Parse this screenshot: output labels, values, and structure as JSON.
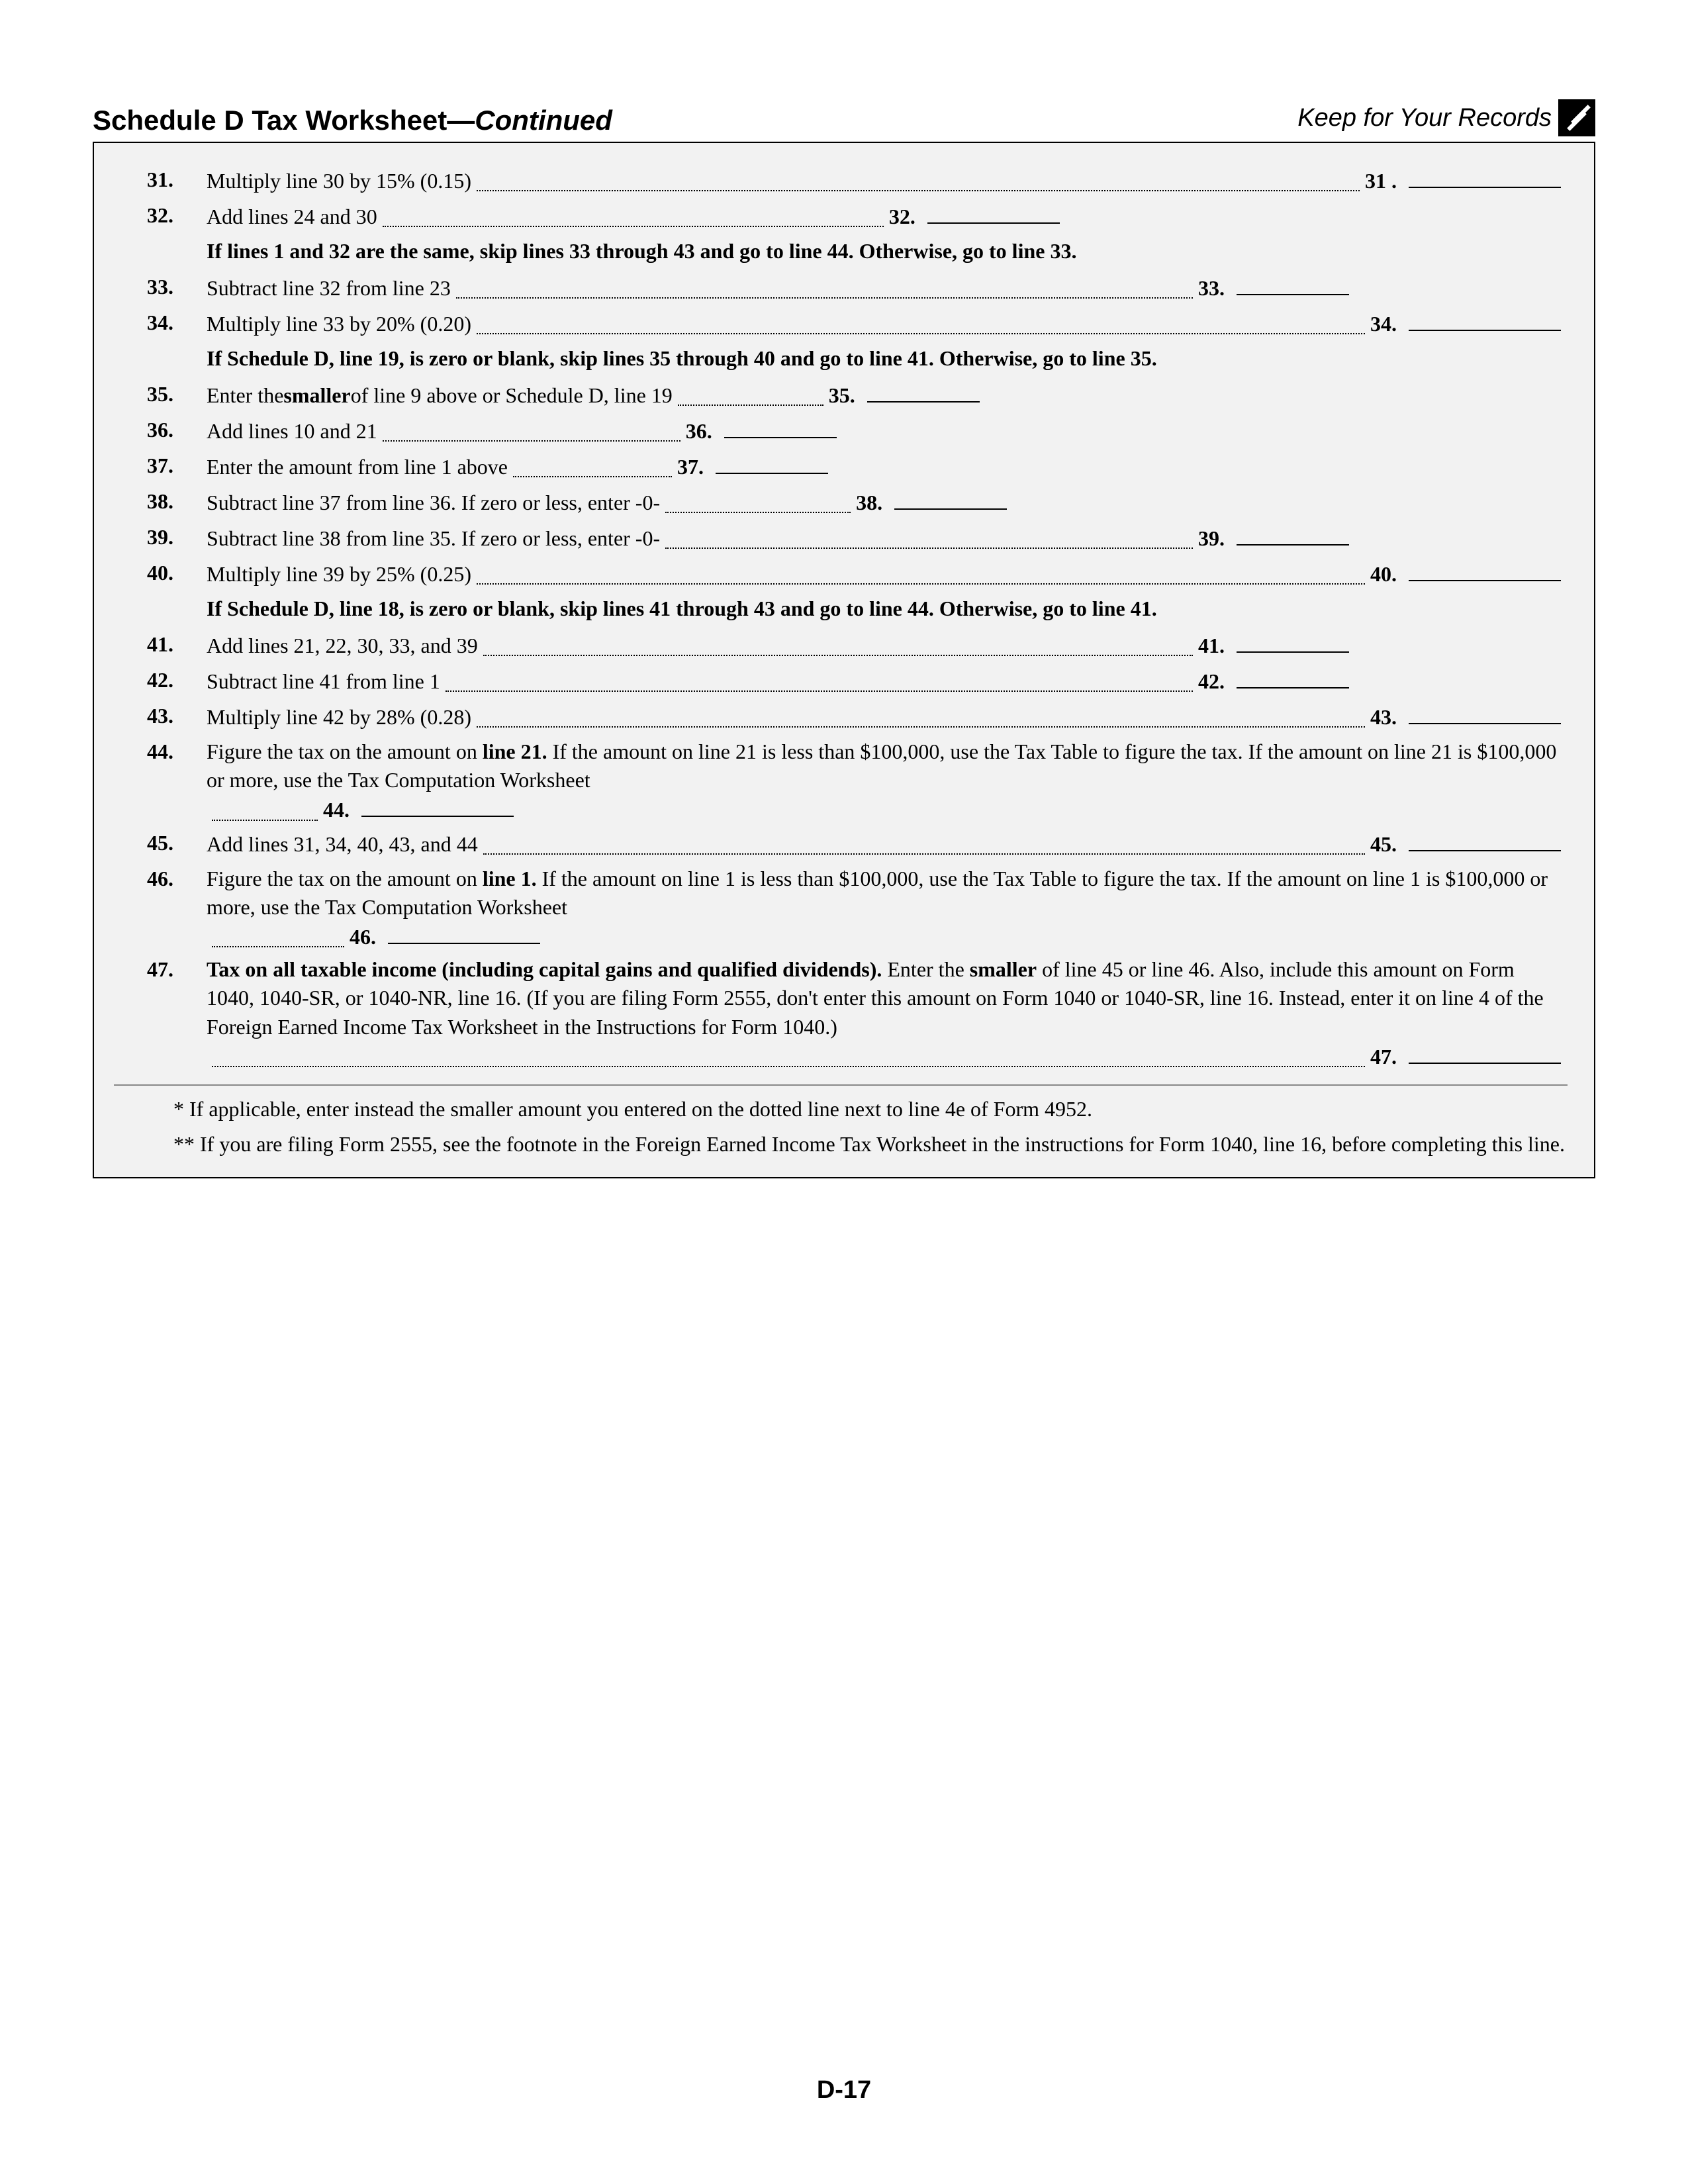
{
  "header": {
    "title_main": "Schedule D Tax Worksheet—",
    "title_cont": "Continued",
    "keep_records": "Keep for Your Records"
  },
  "lines": {
    "31": {
      "num": "31.",
      "text": "Multiply line 30 by 15% (0.15)",
      "end": "31 ."
    },
    "32": {
      "num": "32.",
      "text": "Add lines 24 and 30",
      "end": "32."
    },
    "instr_32": "If lines 1 and 32 are the same, skip lines 33 through 43 and go to line 44. Otherwise, go to line 33.",
    "33": {
      "num": "33.",
      "text": "Subtract line 32 from line 23",
      "end": "33."
    },
    "34": {
      "num": "34.",
      "text": "Multiply line 33 by 20% (0.20)",
      "end": "34."
    },
    "instr_34": "If Schedule D, line 19, is zero or blank, skip lines 35 through 40 and go to line 41. Otherwise, go to line 35.",
    "35": {
      "num": "35.",
      "text_a": "Enter the ",
      "smaller": "smaller",
      "text_b": " of line 9 above or Schedule D, line 19",
      "end": "35."
    },
    "36": {
      "num": "36.",
      "text": "Add lines 10 and 21",
      "end": "36."
    },
    "37": {
      "num": "37.",
      "text": "Enter the amount from line 1 above",
      "end": "37."
    },
    "38": {
      "num": "38.",
      "text": "Subtract line 37 from line 36. If zero or less, enter -0-",
      "end": "38."
    },
    "39": {
      "num": "39.",
      "text": "Subtract line 38 from line 35. If zero or less, enter -0-",
      "end": "39."
    },
    "40": {
      "num": "40.",
      "text": "Multiply line 39 by 25% (0.25)",
      "end": "40."
    },
    "instr_40": "If Schedule D, line 18, is zero or blank, skip lines 41 through 43 and go to line 44. Otherwise, go to line 41.",
    "41": {
      "num": "41.",
      "text": "Add lines 21, 22, 30, 33, and 39",
      "end": "41."
    },
    "42": {
      "num": "42.",
      "text": "Subtract line 41 from line 1",
      "end": "42."
    },
    "43": {
      "num": "43.",
      "text": "Multiply line 42 by 28% (0.28)",
      "end": "43."
    },
    "44": {
      "num": "44.",
      "text_a": "Figure the tax on the amount on ",
      "bold": "line 21.",
      "text_b": " If the amount on line 21 is less than $100,000, use the Tax Table to figure the tax. If the amount on line 21 is $100,000 or more, use the Tax Computation Worksheet",
      "end": "44."
    },
    "45": {
      "num": "45.",
      "text": "Add lines 31, 34, 40, 43, and 44",
      "end": "45."
    },
    "46": {
      "num": "46.",
      "text_a": "Figure the tax on the amount on ",
      "bold": "line 1.",
      "text_b": " If the amount on line 1 is less than $100,000, use the Tax Table to figure the tax. If the amount on line 1 is $100,000 or more, use the Tax Computation Worksheet",
      "end": "46."
    },
    "47": {
      "num": "47.",
      "bold_a": "Tax on all taxable income (including capital gains and qualified dividends).",
      "text_a": " Enter the ",
      "bold_b": "smaller",
      "text_b": " of line 45 or line 46. Also, include this amount on Form 1040, 1040-SR, or 1040-NR, line 16. (If you are filing Form 2555, don't enter this amount on Form 1040 or 1040-SR, line 16. Instead, enter it on line 4 of the Foreign Earned Income Tax Worksheet in the Instructions for Form 1040.)",
      "end": "47."
    }
  },
  "footnotes": {
    "a": "* If applicable, enter instead the smaller amount you entered on the dotted line next to line 4e of Form 4952.",
    "b": "** If you are filing Form 2555, see the footnote in the Foreign Earned Income Tax Worksheet in the instructions for Form 1040, line 16, before completing this line."
  },
  "page_number": "D-17"
}
